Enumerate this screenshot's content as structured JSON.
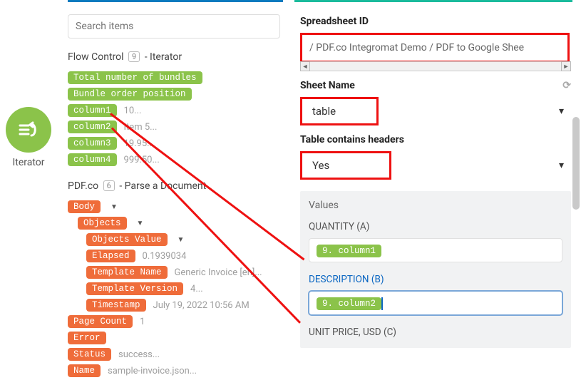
{
  "left": {
    "iterator_label": "Iterator"
  },
  "center": {
    "search_placeholder": "Search items",
    "flow_control": {
      "title_pre": "Flow Control",
      "title_num": "9",
      "title_post": " - Iterator",
      "chips": [
        {
          "text": "Total number of bundles",
          "type": "green",
          "val": ""
        },
        {
          "text": "Bundle order position",
          "type": "green",
          "val": ""
        },
        {
          "text": "column1",
          "type": "green",
          "val": "10..."
        },
        {
          "text": "column2",
          "type": "green",
          "val": "Item 5..."
        },
        {
          "text": "column3",
          "type": "green",
          "val": "19.95..."
        },
        {
          "text": "column4",
          "type": "green",
          "val": "999.50..."
        }
      ]
    },
    "pdfco": {
      "title_pre": "PDF.co",
      "title_num": "6",
      "title_post": " - Parse a Document",
      "rows": [
        {
          "text": "Body",
          "type": "orange",
          "caret": true,
          "val": "",
          "indent": 0
        },
        {
          "text": "Objects",
          "type": "orange",
          "caret": true,
          "val": "",
          "indent": 1
        },
        {
          "text": "Objects Value",
          "type": "orange",
          "caret": true,
          "val": "",
          "indent": 2
        },
        {
          "text": "Elapsed",
          "type": "orange",
          "caret": false,
          "val": "0.1939034",
          "indent": 2
        },
        {
          "text": "Template Name",
          "type": "orange",
          "caret": false,
          "val": "Generic Invoice [en]...",
          "indent": 2
        },
        {
          "text": "Template Version",
          "type": "orange",
          "caret": false,
          "val": "4...",
          "indent": 2
        },
        {
          "text": "Timestamp",
          "type": "orange",
          "caret": false,
          "val": "July 19, 2022 10:56 AM",
          "indent": 2
        },
        {
          "text": "Page Count",
          "type": "orange",
          "caret": false,
          "val": "1",
          "indent": 0
        },
        {
          "text": "Error",
          "type": "orange",
          "caret": false,
          "val": "",
          "indent": 0
        },
        {
          "text": "Status",
          "type": "orange",
          "caret": false,
          "val": "success...",
          "indent": 0
        },
        {
          "text": "Name",
          "type": "orange",
          "caret": false,
          "val": "sample-invoice.json...",
          "indent": 0
        }
      ]
    }
  },
  "right": {
    "spreadsheet_id_label": "Spreadsheet ID",
    "spreadsheet_path": "/ PDF.co Integromat Demo  / PDF to Google Shee",
    "sheet_name_label": "Sheet Name",
    "sheet_name_value": "table",
    "table_headers_label": "Table contains headers",
    "table_headers_value": "Yes",
    "values_header": "Values",
    "col_a_label": "QUANTITY (A)",
    "col_a_pill": "9. column1",
    "col_b_label": "DESCRIPTION (B)",
    "col_b_pill": "9. column2",
    "col_c_label": "UNIT PRICE, USD (C)"
  }
}
